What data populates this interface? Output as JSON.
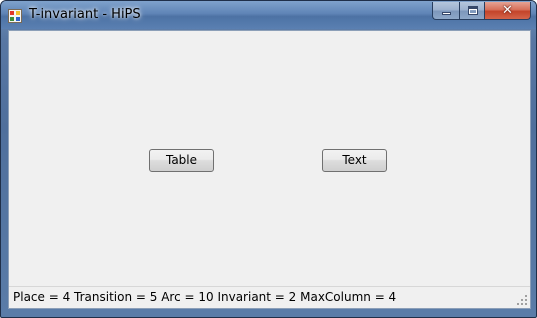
{
  "window": {
    "title": "T-invariant - HiPS",
    "icon": "hips-app-icon",
    "close_glyph": "✕"
  },
  "main": {
    "table_button_label": "Table",
    "text_button_label": "Text"
  },
  "statusbar": {
    "text": "Place = 4  Transition = 5  Arc = 10  Invariant = 2  MaxColumn = 4"
  },
  "colors": {
    "titlebar": "#5f84b6",
    "client_background": "#f0f0f0",
    "close_button": "#c4442a"
  }
}
